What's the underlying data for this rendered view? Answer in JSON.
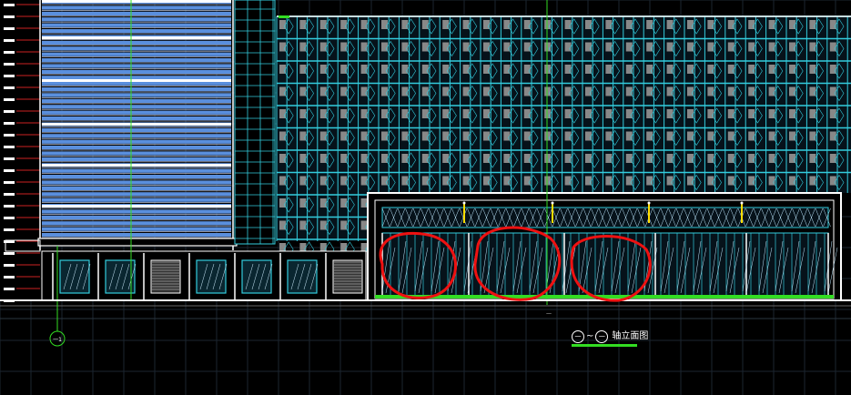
{
  "drawing": {
    "title": "轴立面图",
    "axis_start_label": "一",
    "axis_end_label": "一",
    "separator": "~",
    "grid_marker_label": "一1",
    "dimension_label": "一"
  },
  "colors": {
    "background": "#000000",
    "facade_cyan": "#33ccdd",
    "glass_blue": "#5a8fdd",
    "white": "#ffffff",
    "green": "#33dd22",
    "gray": "#888888",
    "red": "#ee1111",
    "yellow": "#ffdd00"
  },
  "annotations": {
    "red_markup_circles": 3
  }
}
